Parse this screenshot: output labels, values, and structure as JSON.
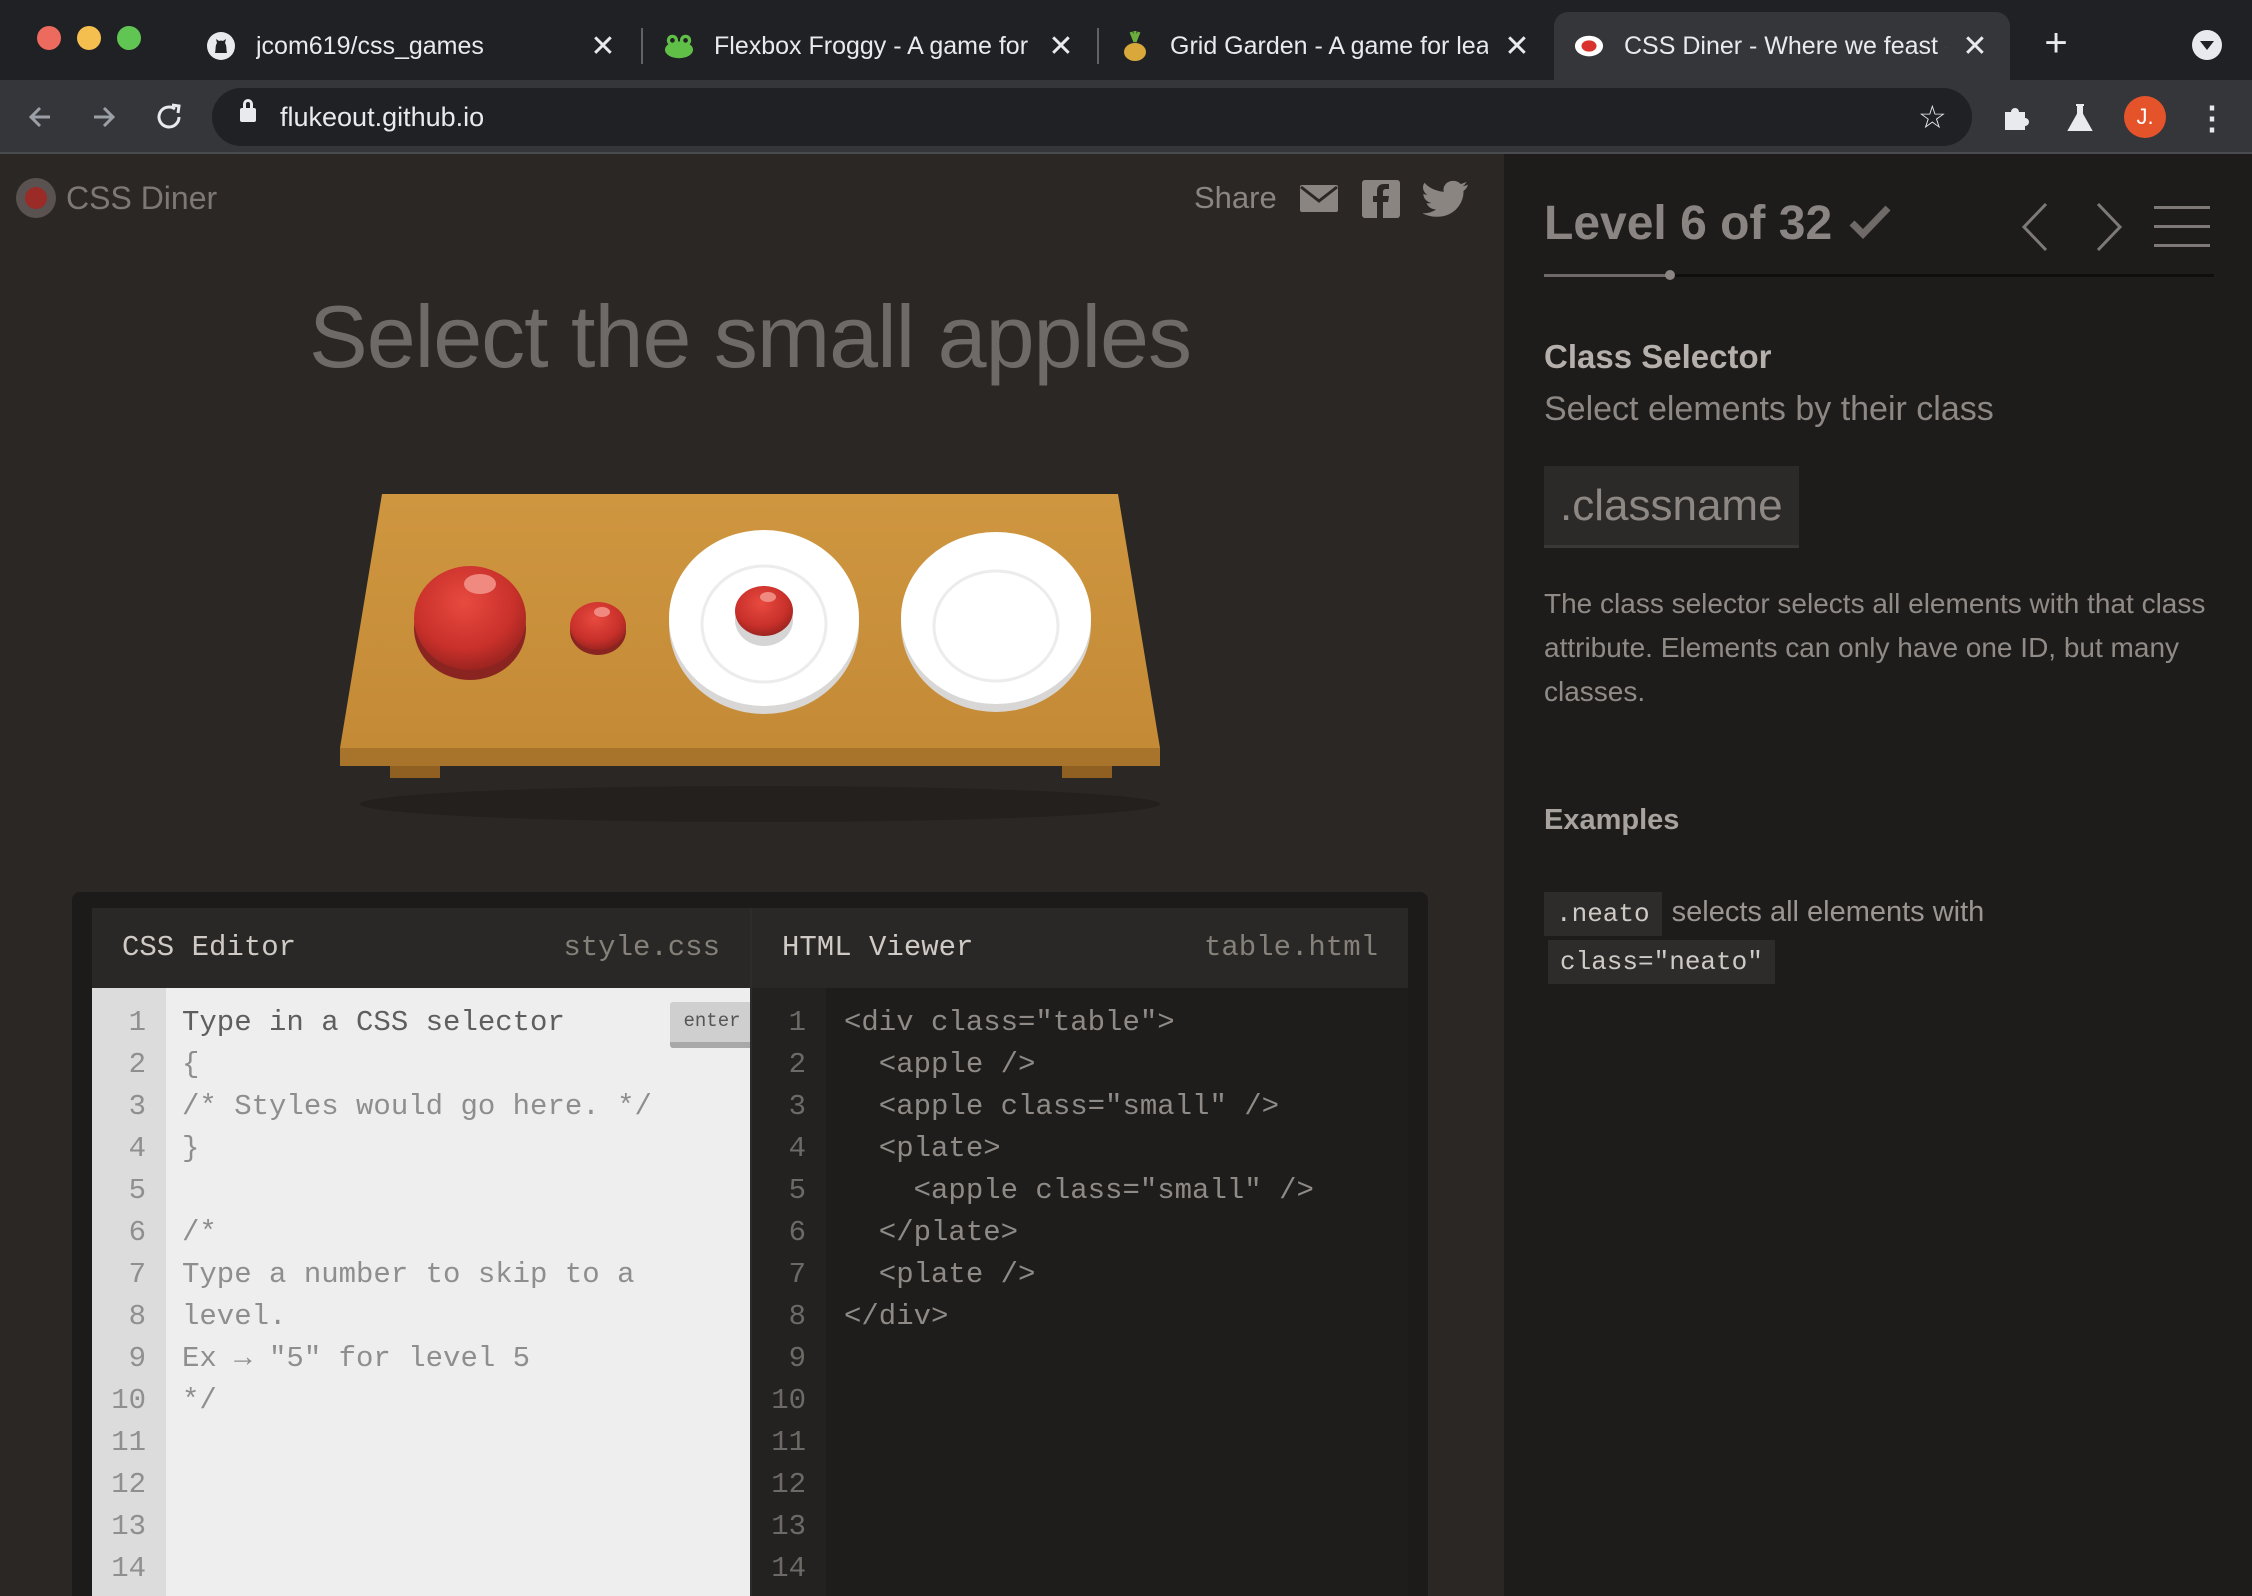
{
  "browser": {
    "tabs": [
      {
        "title": "jcom619/css_games",
        "icon": "github-icon"
      },
      {
        "title": "Flexbox Froggy - A game for",
        "icon": "frog-icon"
      },
      {
        "title": "Grid Garden - A game for lea",
        "icon": "carrot-icon"
      },
      {
        "title": "CSS Diner - Where we feast o",
        "icon": "diner-plate-icon"
      }
    ],
    "close_glyph": "✕",
    "new_tab_glyph": "+",
    "url": "flukeout.github.io",
    "avatar_letter": "J."
  },
  "header": {
    "app_name": "CSS Diner",
    "share_label": "Share"
  },
  "order_text": "Select the small apples",
  "editor": {
    "css_title": "CSS Editor",
    "css_file": "style.css",
    "html_title": "HTML Viewer",
    "html_file": "table.html",
    "enter_label": "enter",
    "line_numbers": [
      "1",
      "2",
      "3",
      "4",
      "5",
      "6",
      "7",
      "8",
      "9",
      "10",
      "11",
      "12",
      "13",
      "14"
    ],
    "css_lines": [
      "Type in a CSS selector",
      "{",
      "/* Styles would go here. */",
      "}",
      "",
      "/*",
      "Type a number to skip to a",
      "level.",
      "Ex → \"5\" for level 5",
      "*/"
    ],
    "html_lines": [
      "<div class=\"table\">",
      "  <apple />",
      "  <apple class=\"small\" />",
      "  <plate>",
      "    <apple class=\"small\" />",
      "  </plate>",
      "  <plate />",
      "</div>"
    ]
  },
  "level": {
    "label": "Level 6 of 32",
    "current": 6,
    "total": 32,
    "completed": true
  },
  "help": {
    "selector_name": "Class Selector",
    "title": "Select elements by their class",
    "syntax": ".classname",
    "hint": "The class selector selects all elements with that class attribute. Elements can only have one ID, but many classes.",
    "examples_title": "Examples",
    "example_code": ".neato",
    "example_text": "selects all elements with",
    "example_code2": "class=\"neato\""
  },
  "colors": {
    "apple": "#c8302a",
    "table": "#c98f3d",
    "plate": "#ffffff"
  }
}
